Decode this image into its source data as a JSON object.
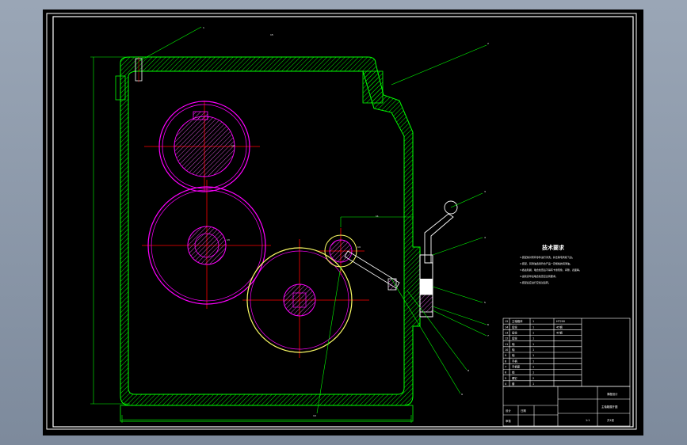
{
  "window": {
    "background": "#8b97a8",
    "canvas_color": "#000000"
  },
  "colors": {
    "frame": "#ffffff",
    "housing": "#00ff00",
    "gear": "#ff00ff",
    "center_line": "#ff0000",
    "leader": "#00ff00",
    "hatch": "#ff66ff",
    "large_gear_outline": "#ffff66",
    "text": "#ffffff"
  },
  "drawing": {
    "technical_requirements_title": "技术要求",
    "technical_requirements": [
      "1.装配前对所有零件进行清洗，并去除毛刺和飞边。",
      "2.装配，润滑油选用符合产品一定规格的润滑油。",
      "3.各齿轮副，啮合检查后不得有卡滞现象，间隙，表面等。",
      "4.齿轮完毕后啮合检查应达到要求。",
      "5.装配后应进行空载试运转。"
    ],
    "leader_labels": [
      "1",
      "2",
      "3",
      "4",
      "5",
      "6",
      "7",
      "8",
      "9",
      "10",
      "11",
      "12",
      "13",
      "14",
      "15"
    ],
    "parts_list": [
      {
        "no": "15",
        "name": "主轴箱体",
        "qty": "1",
        "material": "HT200"
      },
      {
        "no": "14",
        "name": "齿轮",
        "qty": "1",
        "material": "45钢"
      },
      {
        "no": "13",
        "name": "齿轮",
        "qty": "1",
        "material": "45钢"
      },
      {
        "no": "12",
        "name": "齿轮",
        "qty": "1",
        "material": ""
      },
      {
        "no": "11",
        "name": "轴",
        "qty": "1",
        "material": ""
      },
      {
        "no": "10",
        "name": "轴",
        "qty": "1",
        "material": ""
      },
      {
        "no": "9",
        "name": "轴",
        "qty": "1",
        "material": ""
      },
      {
        "no": "8",
        "name": "手柄",
        "qty": "1",
        "material": ""
      },
      {
        "no": "7",
        "name": "手柄座",
        "qty": "1",
        "material": ""
      },
      {
        "no": "6",
        "name": "销",
        "qty": "1",
        "material": ""
      },
      {
        "no": "5",
        "name": "螺钉",
        "qty": "2",
        "material": ""
      },
      {
        "no": "4",
        "name": "套",
        "qty": "1",
        "material": ""
      }
    ],
    "title_block": {
      "drawing_title": "主轴箱展开图",
      "company": "课程设计",
      "scale": "1:1",
      "sheet": "共1张",
      "designer": "设计",
      "checker": "审核",
      "date": "日期"
    }
  }
}
